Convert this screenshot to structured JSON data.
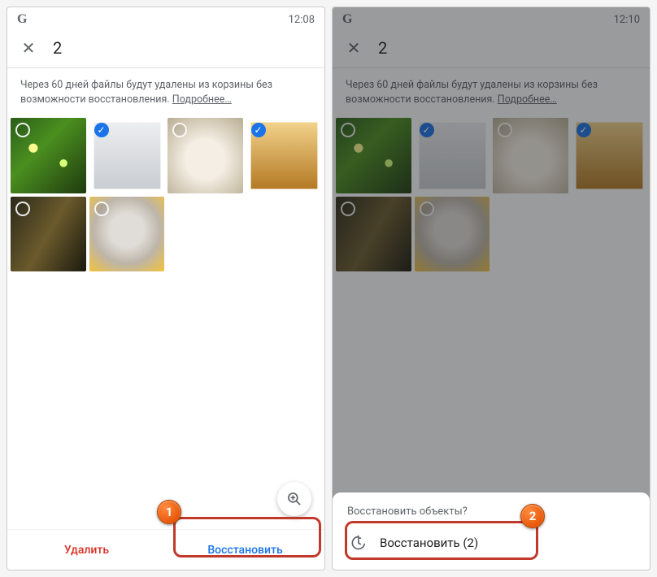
{
  "left": {
    "status": {
      "logo": "G",
      "time": "12:08"
    },
    "appbar": {
      "close_icon": "✕",
      "count": "2"
    },
    "banner": {
      "text": "Через 60 дней файлы будут удалены из корзины без возможности восстановления.",
      "more": "Подробнее…"
    },
    "thumbs": [
      {
        "img": "img-green-bokeh",
        "selected": false
      },
      {
        "img": "img-dogs-pair",
        "selected": true
      },
      {
        "img": "img-guinea-pig",
        "selected": false
      },
      {
        "img": "img-golden",
        "selected": true
      },
      {
        "img": "img-monkey",
        "selected": false
      },
      {
        "img": "img-dog-hat",
        "selected": false
      }
    ],
    "zoom_icon": "⊕",
    "actions": {
      "delete": "Удалить",
      "restore": "Восстановить"
    }
  },
  "right": {
    "status": {
      "logo": "G",
      "time": "12:10"
    },
    "appbar": {
      "close_icon": "✕",
      "count": "2"
    },
    "banner": {
      "text": "Через 60 дней файлы будут удалены из корзины без возможности восстановления.",
      "more": "Подробнее…"
    },
    "thumbs": [
      {
        "img": "img-green-bokeh",
        "selected": false
      },
      {
        "img": "img-dogs-pair",
        "selected": true
      },
      {
        "img": "img-guinea-pig",
        "selected": false
      },
      {
        "img": "img-golden",
        "selected": true
      },
      {
        "img": "img-monkey",
        "selected": false
      },
      {
        "img": "img-dog-hat",
        "selected": false
      }
    ],
    "sheet": {
      "title": "Восстановить объекты?",
      "action_label": "Восстановить (2)"
    }
  },
  "markers": {
    "one": "1",
    "two": "2"
  }
}
